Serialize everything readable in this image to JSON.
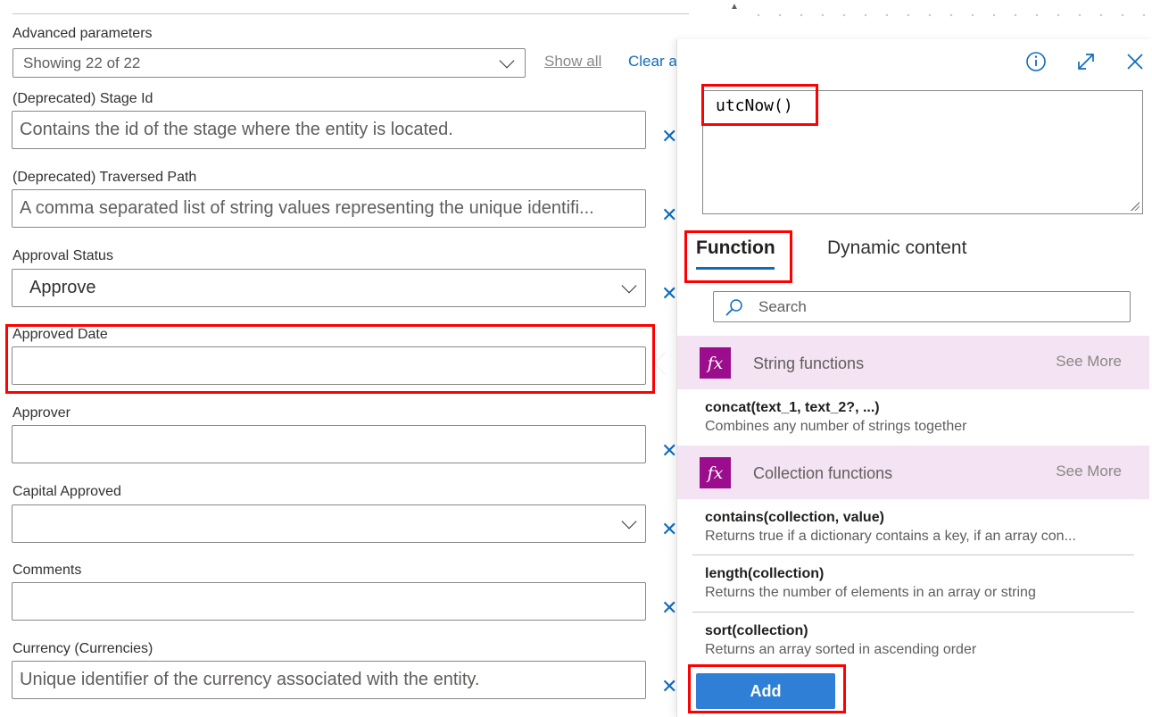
{
  "advanced": {
    "label": "Advanced parameters",
    "select_value": "Showing 22 of 22",
    "show_all": "Show all",
    "clear_all": "Clear a"
  },
  "fields": [
    {
      "label": "(Deprecated) Stage Id",
      "value": "Contains the id of the stage where the entity is located."
    },
    {
      "label": "(Deprecated) Traversed Path",
      "value": "A comma separated list of string values representing the unique identifi..."
    },
    {
      "label": "Approval Status",
      "value": "Approve"
    },
    {
      "label": "Approved Date",
      "value": ""
    },
    {
      "label": "Approver",
      "value": ""
    },
    {
      "label": "Capital Approved",
      "value": ""
    },
    {
      "label": "Comments",
      "value": ""
    },
    {
      "label": "Currency (Currencies)",
      "value": "Unique identifier of the currency associated with the entity."
    }
  ],
  "remove_glyph": "✕",
  "panel": {
    "expression": "utcNow()",
    "tabs": [
      "Function",
      "Dynamic content"
    ],
    "search_placeholder": "Search",
    "categories": [
      {
        "name": "String functions",
        "see_more": "See More",
        "icon": "fx-icon"
      },
      {
        "name": "Collection functions",
        "see_more": "See More",
        "icon": "fx-icon"
      }
    ],
    "functions": [
      {
        "name": "concat(text_1, text_2?, ...)",
        "desc": "Combines any number of strings together"
      },
      {
        "name": "contains(collection, value)",
        "desc": "Returns true if a dictionary contains a key, if an array con..."
      },
      {
        "name": "length(collection)",
        "desc": "Returns the number of elements in an array or string"
      },
      {
        "name": "sort(collection)",
        "desc": "Returns an array sorted in ascending order"
      }
    ],
    "fx_glyph": "fx",
    "add_label": "Add"
  },
  "colors": {
    "accent": "#0f6cbd",
    "highlight": "#ff0000",
    "category_bg": "#f4e3f2",
    "fx_bg": "#9b0d8d"
  }
}
